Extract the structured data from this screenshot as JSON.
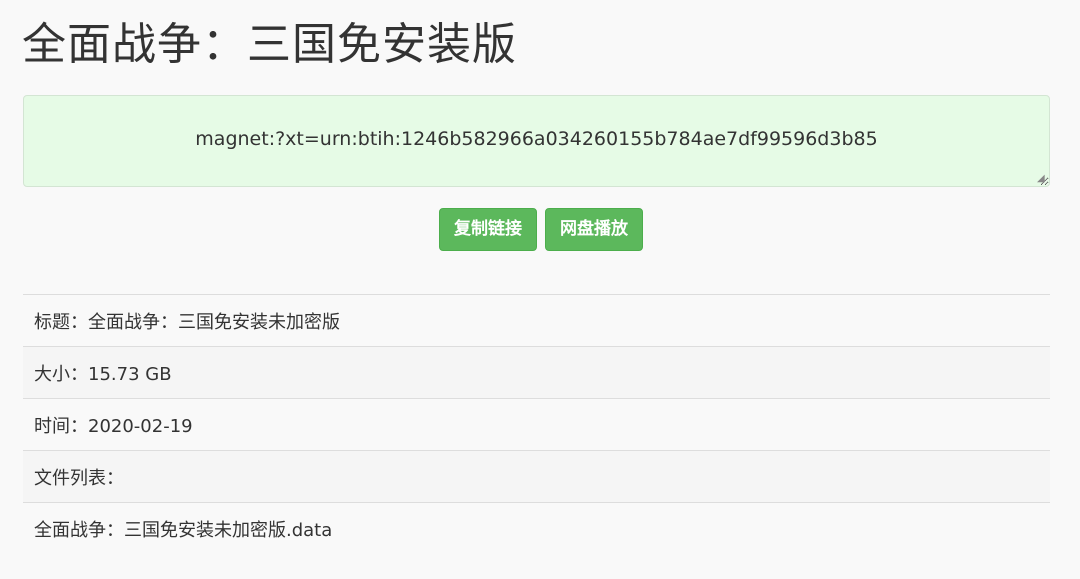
{
  "page": {
    "title": "全面战争：三国免安装版"
  },
  "magnet": {
    "value": "magnet:?xt=urn:btih:1246b582966a034260155b784ae7df99596d3b85"
  },
  "actions": {
    "copy_label": "复制链接",
    "play_label": "网盘播放"
  },
  "info": {
    "rows": [
      {
        "label": "标题：",
        "value": "全面战争：三国免安装未加密版"
      },
      {
        "label": "大小：",
        "value": "15.73 GB"
      },
      {
        "label": "时间：",
        "value": "2020-02-19"
      },
      {
        "label": "文件列表：",
        "value": ""
      },
      {
        "label": "",
        "value": "全面战争：三国免安装未加密版.data"
      }
    ]
  },
  "colors": {
    "page_bg": "#f9f9f9",
    "magnet_bg": "#e6fbe6",
    "button_bg": "#5cb85c",
    "divider": "#dddddd"
  }
}
